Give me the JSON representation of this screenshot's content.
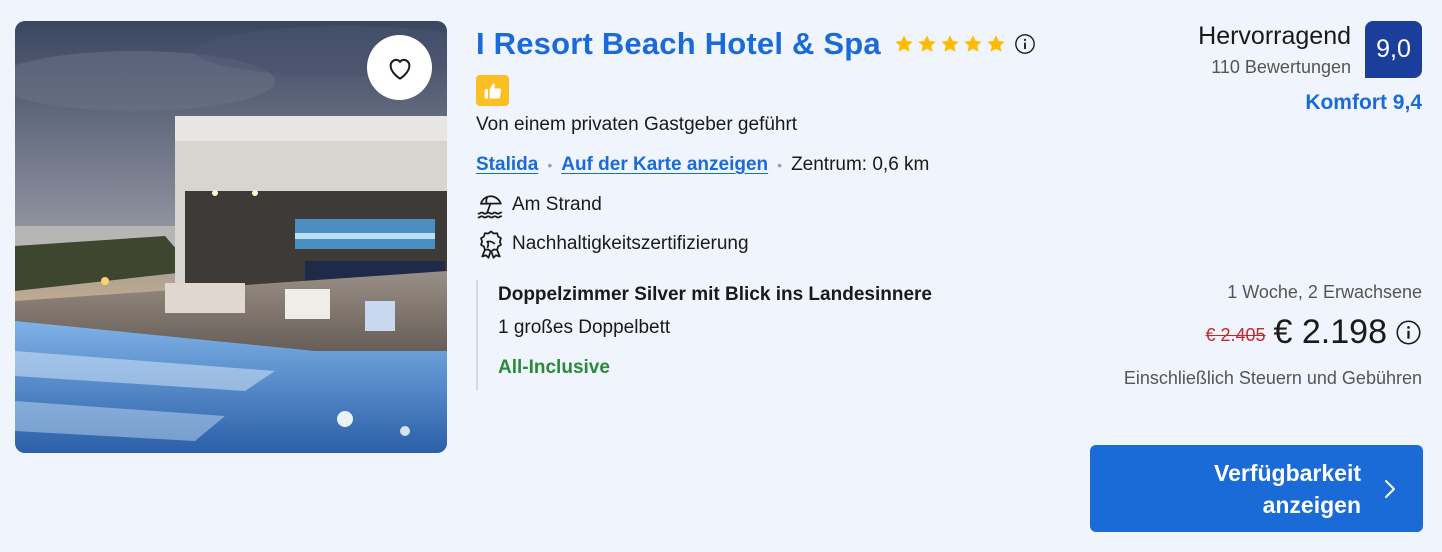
{
  "hotel": {
    "name": "I Resort Beach Hotel & Spa",
    "star_count": 5,
    "host_text": "Von einem privaten Gastgeber geführt",
    "location_link": "Stalida",
    "map_link": "Auf der Karte anzeigen",
    "distance": "Zentrum: 0,6 km",
    "features": [
      "Am Strand",
      "Nachhaltigkeitszertifizierung"
    ]
  },
  "icons": {
    "favorite": "heart-icon",
    "info": "info-icon",
    "thumbs_up": "thumbs-up-icon",
    "beach": "beach-umbrella-icon",
    "sustainability": "certificate-badge-icon",
    "chevron": "chevron-right-icon"
  },
  "rating": {
    "label": "Hervorragend",
    "reviews": "110 Bewertungen",
    "score": "9,0",
    "comfort": "Komfort 9,4"
  },
  "room": {
    "name": "Doppelzimmer Silver mit Blick ins Landesinnere",
    "bed": "1 großes Doppelbett",
    "board": "All-Inclusive"
  },
  "pricing": {
    "stay": "1 Woche, 2 Erwachsene",
    "old_price": "€ 2.405",
    "price": "€ 2.198",
    "taxes": "Einschließlich Steuern und Gebühren"
  },
  "cta": {
    "label": "Verfügbarkeit anzeigen"
  },
  "colors": {
    "brand_blue": "#1a6ad8",
    "score_badge": "#1b3e9a",
    "star": "#febb02",
    "thumb_badge": "#fbbf24",
    "old_price_red": "#c62828",
    "inclusive_green": "#2a8a3a",
    "background": "#f0f4fc"
  }
}
